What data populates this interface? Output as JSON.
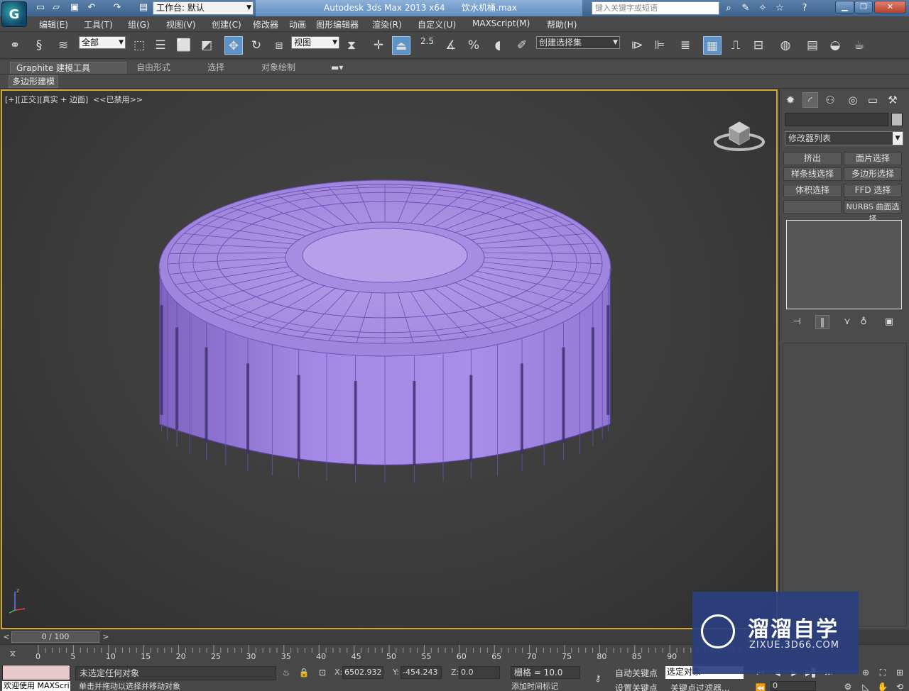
{
  "window": {
    "app_logo": "G",
    "workspace_label": "工作台: 默认",
    "title_app": "Autodesk 3ds Max  2013 x64",
    "title_file": "饮水机桶.max",
    "search_placeholder": "键入关键字或短语",
    "buttons": {
      "minimize": "▁",
      "restore": "❐",
      "close": "✕"
    }
  },
  "menus": [
    "编辑(E)",
    "工具(T)",
    "组(G)",
    "视图(V)",
    "创建(C)",
    "修改器",
    "动画",
    "图形编辑器",
    "渲染(R)",
    "自定义(U)",
    "MAXScript(M)",
    "帮助(H)"
  ],
  "toolbar": {
    "selection_filter": "全部",
    "ref_coord": "视图",
    "snap_angle_label": "2.5",
    "named_selection": "创建选择集"
  },
  "ribbon": {
    "tabs": [
      "Graphite 建模工具",
      "自由形式",
      "选择",
      "对象绘制"
    ],
    "active_tab": 0,
    "sub_tab": "多边形建模"
  },
  "viewport": {
    "label": "[+][正交][真实 + 边面]  <<已禁用>>",
    "gizmo_axis": "z",
    "model_color": "#a98ee8",
    "border_color": "#d0a83a"
  },
  "command_panel": {
    "modifier_list": "修改器列表",
    "buttons": [
      [
        "挤出",
        "面片选择"
      ],
      [
        "样条线选择",
        "多边形选择"
      ],
      [
        "体积选择",
        "FFD 选择"
      ],
      [
        "",
        "NURBS 曲面选择"
      ]
    ]
  },
  "timeline": {
    "frame_display": "0 / 100",
    "ticks": [
      "0",
      "5",
      "10",
      "15",
      "20",
      "25",
      "30",
      "35",
      "40",
      "45",
      "50",
      "55",
      "60",
      "65",
      "70",
      "75",
      "80",
      "85",
      "90"
    ]
  },
  "status": {
    "maxscript_line": "欢迎使用 MAXScri",
    "selection_status": "未选定任何对象",
    "prompt": "单击并拖动以选择并移动对象",
    "x_label": "X:",
    "x_value": "6502.932",
    "y_label": "Y:",
    "y_value": "-454.243",
    "z_label": "Z:",
    "z_value": "0.0",
    "grid": "栅格 = 10.0",
    "auto_key": "自动关键点",
    "set_key": "设置关键点",
    "selected_set": "选定对象",
    "key_filter": "关键点过滤器...",
    "add_time_tag": "添加时间标记",
    "current_frame": "0"
  },
  "watermark": {
    "title": "溜溜自学",
    "url": "ZIXUE.3D66.COM"
  }
}
